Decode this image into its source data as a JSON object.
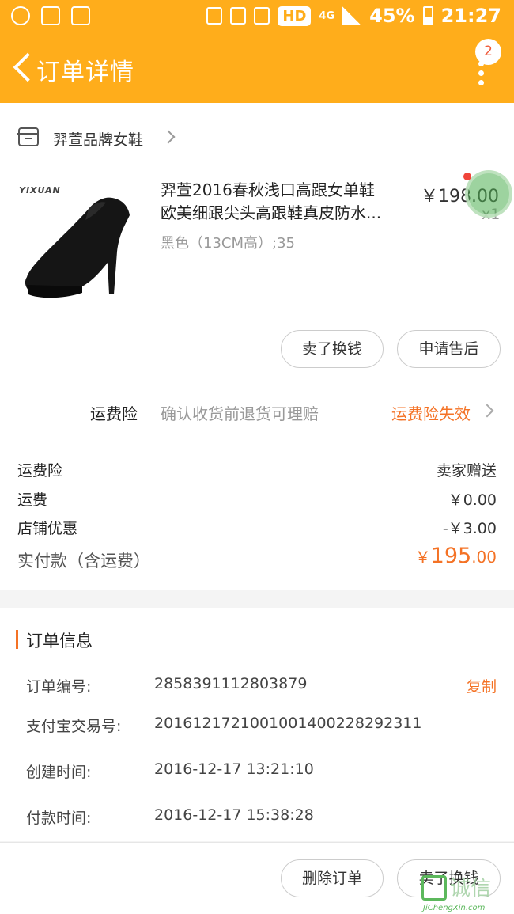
{
  "status_bar": {
    "hd": "HD",
    "network": "4G",
    "battery": "45%",
    "time": "21:27"
  },
  "nav": {
    "title": "订单详情",
    "badge_count": "2"
  },
  "shop": {
    "name": "羿萱品牌女鞋"
  },
  "product": {
    "brand_logo": "YIXUAN",
    "title_line1": "羿萱2016春秋浅口高跟女单鞋",
    "title_line2": "欧美细跟尖头高跟鞋真皮防水...",
    "spec": "黑色（13CM高）;35",
    "price": "￥198.00",
    "quantity": "x1"
  },
  "product_actions": {
    "sell_label": "卖了换钱",
    "after_sale_label": "申请售后"
  },
  "insurance": {
    "label": "运费险",
    "description": "确认收货前退货可理赔",
    "status": "运费险失效"
  },
  "fees": [
    {
      "label": "运费险",
      "value": "卖家赠送"
    },
    {
      "label": "运费",
      "value": "￥0.00"
    },
    {
      "label": "店铺优惠",
      "value": "-￥3.00"
    }
  ],
  "total": {
    "label": "实付款（含运费）",
    "currency": "￥",
    "integer": "195",
    "decimal": ".00"
  },
  "order_info": {
    "title": "订单信息",
    "copy_label": "复制",
    "rows": [
      {
        "label": "订单编号:",
        "value": "2858391112803879"
      },
      {
        "label": "支付宝交易号:",
        "value": "2016121721001001400228292311"
      },
      {
        "label": "创建时间:",
        "value": "2016-12-17 13:21:10"
      },
      {
        "label": "付款时间:",
        "value": "2016-12-17 15:38:28"
      }
    ]
  },
  "bottom_actions": {
    "delete_label": "删除订单",
    "sell_label": "卖了换钱"
  },
  "watermark": {
    "cn": "诚信",
    "en": "JiChengXin.com"
  },
  "colors": {
    "brand": "#ffad1b",
    "accent": "#f47225"
  },
  "icons": [
    "back-arrow-icon",
    "more-vertical-icon",
    "shop-icon",
    "chevron-right-icon",
    "shoe-image"
  ]
}
